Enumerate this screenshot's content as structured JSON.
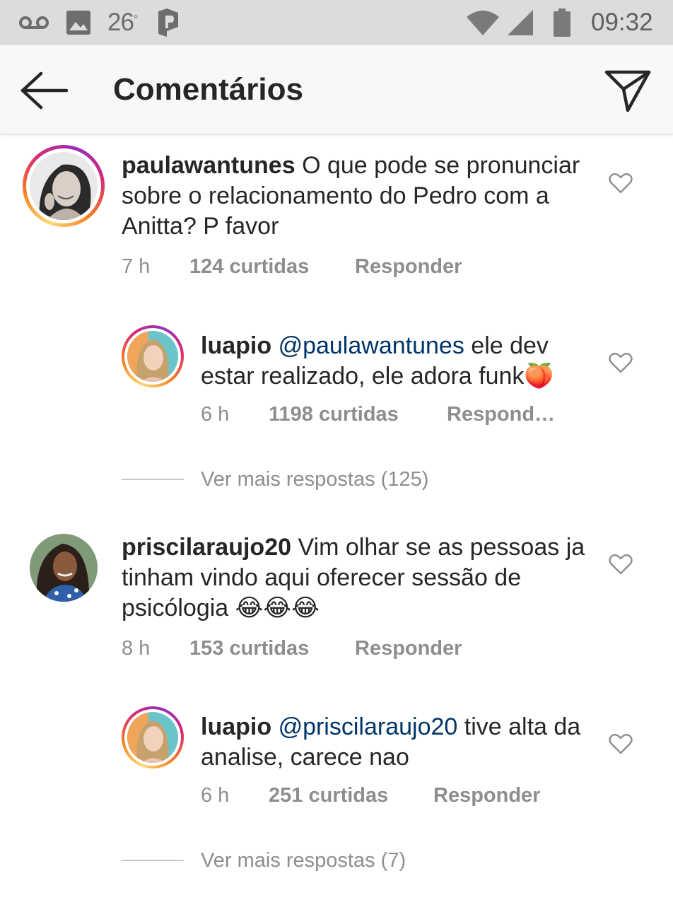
{
  "status_bar": {
    "temperature": "26",
    "degree": "°",
    "time": "09:32",
    "icons": [
      "voicemail-icon",
      "image-icon",
      "parking-icon",
      "wifi-icon",
      "signal-icon",
      "battery-icon"
    ]
  },
  "header": {
    "title": "Comentários",
    "back_icon": "arrow-left-icon",
    "share_icon": "paper-plane-icon"
  },
  "comments": [
    {
      "username": "paulawantunes",
      "text": "O que pode se pronunciar sobre o relacionamento do Pedro com a Anitta?  P favor",
      "time": "7 h",
      "likes": "124 curtidas",
      "reply": "Responder"
    },
    {
      "username": "luapio",
      "mention": "@paulawantunes",
      "text": "ele dev estar realizado, ele adora funk🍑",
      "time": "6 h",
      "likes": "1198 curtidas",
      "reply": "Respond…"
    },
    {
      "username": "priscilaraujo20",
      "text": "Vim olhar se as pessoas ja tinham vindo aqui oferecer sessão de psicólogia 😂😂😂",
      "time": "8 h",
      "likes": "153 curtidas",
      "reply": "Responder"
    },
    {
      "username": "luapio",
      "mention": "@priscilaraujo20",
      "text": "tive alta da analise, carece nao",
      "time": "6 h",
      "likes": "251 curtidas",
      "reply": "Responder"
    }
  ],
  "more_replies": [
    "Ver mais respostas (125)",
    "Ver mais respostas (7)"
  ],
  "colors": {
    "status_bar_bg": "#dcdcdc",
    "header_bg": "#f8f8f8",
    "text": "#262626",
    "muted": "#8e8e8e",
    "mention": "#003569"
  }
}
